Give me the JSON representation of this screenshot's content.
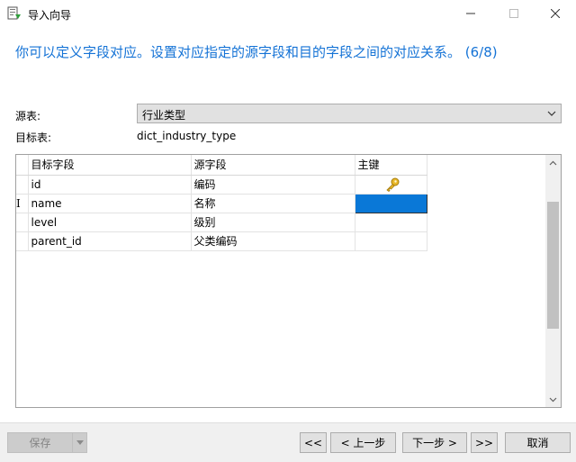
{
  "window": {
    "title": "导入向导"
  },
  "heading": "你可以定义字段对应。设置对应指定的源字段和目的字段之间的对应关系。 (6/8)",
  "source": {
    "label": "源表:",
    "value": "行业类型"
  },
  "target": {
    "label": "目标表:",
    "value": "dict_industry_type"
  },
  "grid": {
    "headers": {
      "target_field": "目标字段",
      "source_field": "源字段",
      "primary_key": "主键"
    },
    "rows": [
      {
        "target": "id",
        "source": "编码",
        "key": "key-icon"
      },
      {
        "target": "name",
        "source": "名称",
        "key": "",
        "selected": true,
        "cursor": "I"
      },
      {
        "target": "level",
        "source": "级别",
        "key": ""
      },
      {
        "target": "parent_id",
        "source": "父类编码",
        "key": ""
      }
    ]
  },
  "footer": {
    "save": "保存",
    "first": "<<",
    "prev": "< 上一步",
    "next": "下一步 >",
    "last": ">>",
    "cancel": "取消"
  },
  "colors": {
    "heading": "#1573d6",
    "selection": "#0a78d7",
    "key_icon": "#e8b82a"
  }
}
